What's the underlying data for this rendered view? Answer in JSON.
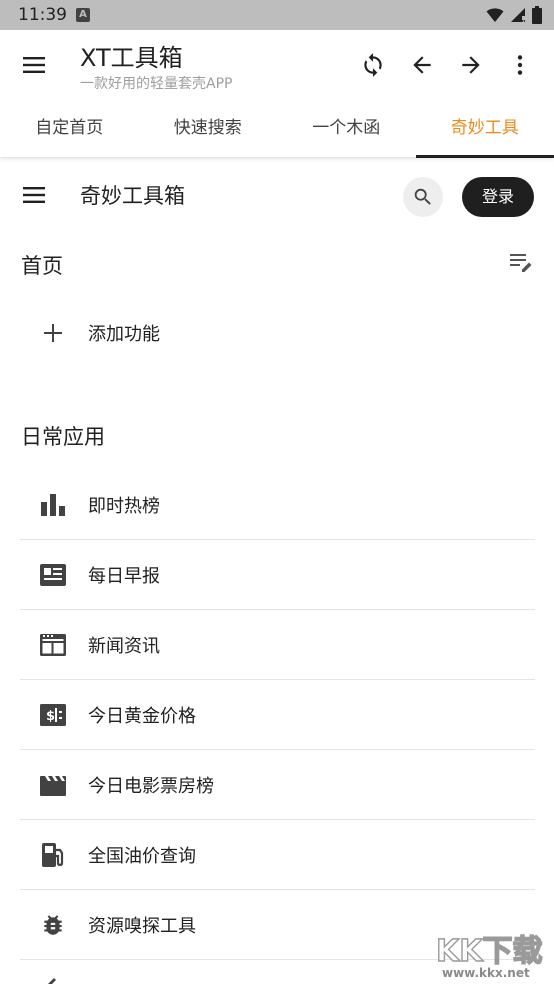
{
  "status_bar": {
    "time": "11:39",
    "notification": "A",
    "icons": [
      "wifi-icon",
      "signal-icon",
      "battery-icon"
    ]
  },
  "app_bar": {
    "title": "XT工具箱",
    "subtitle": "一款好用的轻量套壳APP",
    "actions": [
      "refresh-icon",
      "back-arrow-icon",
      "forward-arrow-icon",
      "more-vert-icon"
    ]
  },
  "tabs": [
    {
      "label": "自定首页",
      "active": false
    },
    {
      "label": "快速搜索",
      "active": false
    },
    {
      "label": "一个木函",
      "active": false
    },
    {
      "label": "奇妙工具",
      "active": true
    }
  ],
  "web_header": {
    "title": "奇妙工具箱",
    "login_label": "登录"
  },
  "home": {
    "title": "首页",
    "add_label": "添加功能"
  },
  "daily": {
    "title": "日常应用",
    "items": [
      {
        "label": "即时热榜",
        "icon": "bar-chart-icon"
      },
      {
        "label": "每日早报",
        "icon": "newspaper-icon"
      },
      {
        "label": "新闻资讯",
        "icon": "web-news-icon"
      },
      {
        "label": "今日黄金价格",
        "icon": "money-icon"
      },
      {
        "label": "今日电影票房榜",
        "icon": "movie-icon"
      },
      {
        "label": "全国油价查询",
        "icon": "gas-station-icon"
      },
      {
        "label": "资源嗅探工具",
        "icon": "bug-icon"
      }
    ]
  },
  "watermark": {
    "text": "KK下载",
    "url": "www.kkx.net"
  },
  "colors": {
    "accent": "#ef8a1b",
    "status_bar": "#bdbdbd",
    "login_button": "#1f1f1f"
  }
}
